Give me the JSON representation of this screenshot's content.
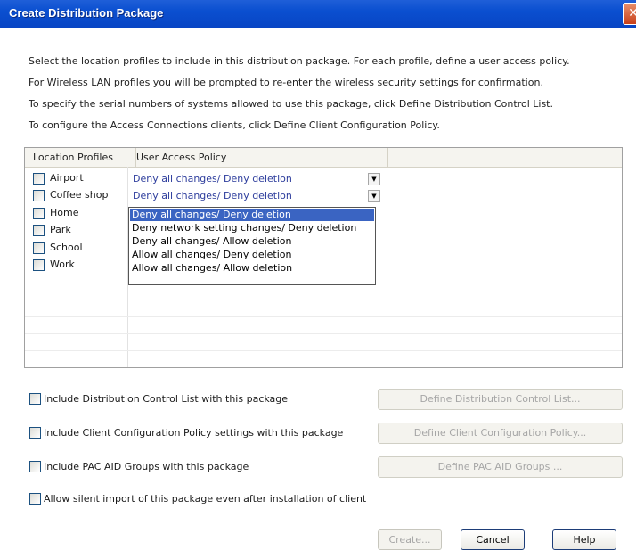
{
  "window": {
    "title": "Create Distribution Package",
    "close_glyph": "✕"
  },
  "instructions": [
    "Select the location profiles to include in this distribution package. For each profile, define a user access policy.",
    "For Wireless LAN profiles you will be prompted to re-enter the wireless security settings for confirmation.",
    "To specify the serial numbers of systems allowed to use this package, click Define Distribution Control List.",
    "To configure the Access Connections clients, click Define Client Configuration Policy."
  ],
  "table": {
    "headers": {
      "profiles": "Location Profiles",
      "policy": "User Access Policy"
    },
    "profiles": [
      "Airport",
      "Coffee shop",
      "Home",
      "Park",
      "School",
      "Work"
    ],
    "policies": [
      "Deny all changes/ Deny deletion",
      "Deny all changes/ Deny deletion"
    ],
    "dropdown_glyph": "▼",
    "dropdown_options": [
      "Deny all changes/ Deny deletion",
      "Deny network setting changes/ Deny deletion",
      "Deny all changes/ Allow deletion",
      "Allow all changes/ Deny deletion",
      "Allow all changes/ Allow deletion"
    ]
  },
  "options": {
    "dcl_label": "Include Distribution Control List with this package",
    "ccp_label": "Include Client Configuration Policy settings with this package",
    "pac_label": "Include PAC AID Groups with this package",
    "silent_label": "Allow silent import of this package even after installation of client",
    "dcl_button": "Define Distribution Control List...",
    "ccp_button": "Define Client Configuration Policy...",
    "pac_button": "Define PAC AID Groups ..."
  },
  "footer": {
    "create": "Create...",
    "cancel": "Cancel",
    "help": "Help"
  }
}
